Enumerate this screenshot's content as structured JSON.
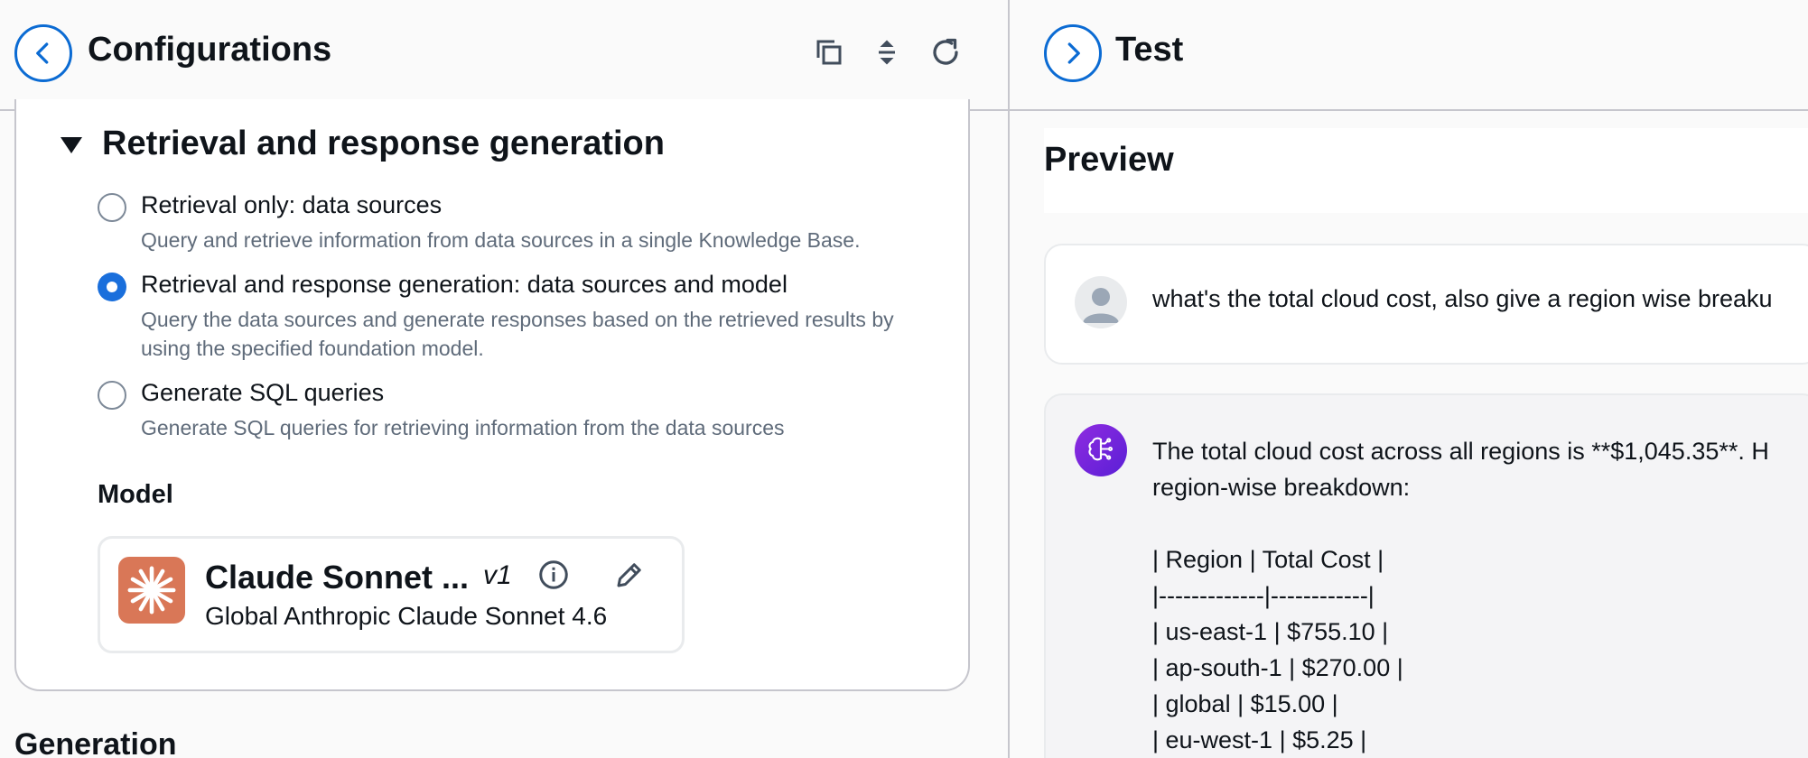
{
  "colors": {
    "accent": "#0b6bd3",
    "radio_selected": "#1a6fdc",
    "model_logo": "#d97757",
    "bot_avatar": "#7b26dd"
  },
  "left": {
    "title": "Configurations",
    "back_icon": "chevron-left-icon",
    "toolbar_icons": [
      "copy-icon",
      "expand-collapse-icon",
      "refresh-icon"
    ],
    "section": {
      "title": "Retrieval and response generation",
      "toggle_icon": "caret-down-icon",
      "options": [
        {
          "label": "Retrieval only: data sources",
          "description": "Query and retrieve information from data sources in a single Knowledge Base.",
          "selected": false
        },
        {
          "label": "Retrieval and response generation: data sources and model",
          "description": "Query the data sources and generate responses based on the retrieved results by using the specified foundation model.",
          "selected": true
        },
        {
          "label": "Generate SQL queries",
          "description": "Generate SQL queries for retrieving information from the data sources",
          "selected": false
        }
      ],
      "model_heading": "Model",
      "model": {
        "name": "Claude Sonnet ...",
        "version": "v1",
        "subtitle": "Global Anthropic Claude Sonnet 4.6",
        "icons": [
          "info-icon",
          "edit-icon"
        ]
      }
    },
    "next_section": "Generation"
  },
  "right": {
    "title": "Test",
    "forward_icon": "chevron-right-icon",
    "preview_title": "Preview",
    "user_message": "what's the total cloud cost, also give a region wise breaku",
    "bot_lines": [
      "  The total cloud cost across all regions is **$1,045.35**. H",
      "region-wise breakdown:",
      "",
      "| Region | Total Cost |",
      "|-------------|------------|",
      "| us-east-1 | $755.10 |",
      "| ap-south-1 | $270.00 |",
      "| global | $15.00 |",
      "| eu-west-1 | $5.25 |"
    ]
  }
}
